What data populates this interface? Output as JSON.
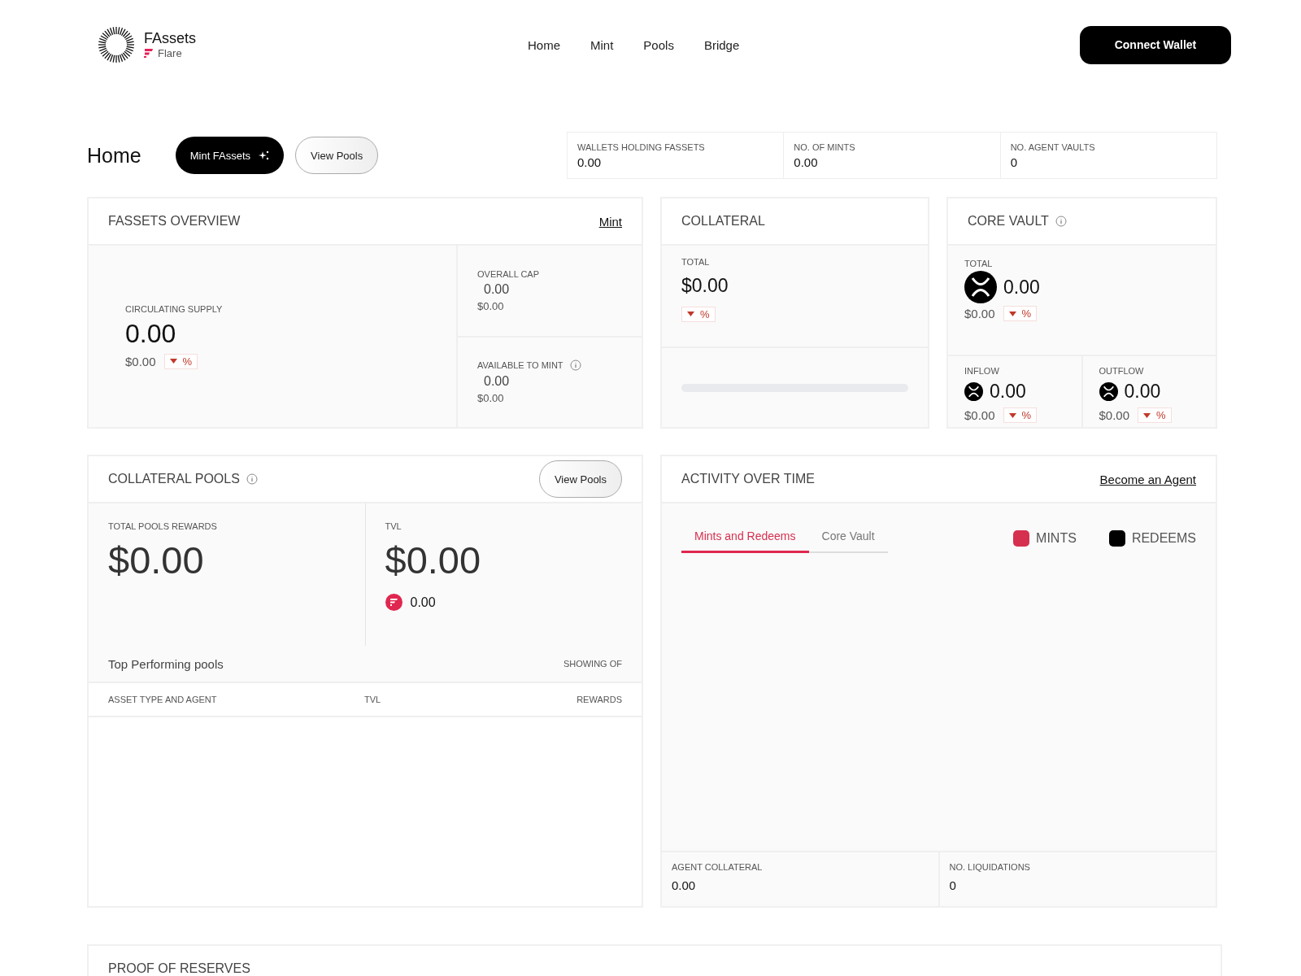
{
  "header": {
    "brand": "FAssets",
    "network": "Flare",
    "nav": [
      {
        "label": "Home"
      },
      {
        "label": "Mint"
      },
      {
        "label": "Pools"
      },
      {
        "label": "Bridge"
      }
    ],
    "connect_button": "Connect Wallet"
  },
  "page": {
    "title": "Home",
    "mint_button": "Mint FAssets",
    "view_pools_button": "View Pools"
  },
  "stats": [
    {
      "label": "WALLETS HOLDING FASSETS",
      "value": "0.00"
    },
    {
      "label": "NO. OF MINTS",
      "value": "0.00"
    },
    {
      "label": "NO. AGENT VAULTS",
      "value": "0"
    }
  ],
  "fassets_overview": {
    "title": "FASSETS OVERVIEW",
    "link": "Mint",
    "circulating": {
      "label": "CIRCULATING SUPPLY",
      "value": "0.00",
      "usd": "$0.00",
      "change": "%"
    },
    "overall_cap": {
      "label": "OVERALL CAP",
      "value": "0.00",
      "usd": "$0.00"
    },
    "available": {
      "label": "AVAILABLE TO MINT",
      "value": "0.00",
      "usd": "$0.00"
    }
  },
  "collateral": {
    "title": "COLLATERAL",
    "total_label": "TOTAL",
    "total": "$0.00",
    "change": "%"
  },
  "core_vault": {
    "title": "CORE VAULT",
    "total_label": "TOTAL",
    "total": "0.00",
    "usd": "$0.00",
    "change": "%",
    "flows": [
      {
        "label": "INFLOW",
        "value": "0.00",
        "usd": "$0.00",
        "change": "%"
      },
      {
        "label": "OUTFLOW",
        "value": "0.00",
        "usd": "$0.00",
        "change": "%"
      }
    ]
  },
  "collateral_pools": {
    "title": "COLLATERAL POOLS",
    "button": "View Pools",
    "rewards_label": "TOTAL POOLS REWARDS",
    "rewards": "$0.00",
    "tvl_label": "TVL",
    "tvl": "$0.00",
    "flr": "0.00",
    "top_title": "Top Performing pools",
    "showing": "SHOWING OF",
    "columns": [
      "ASSET TYPE AND AGENT",
      "TVL",
      "REWARDS"
    ]
  },
  "activity": {
    "title": "ACTIVITY OVER TIME",
    "link": "Become an Agent",
    "tabs": [
      {
        "label": "Mints and Redeems",
        "selected": true
      },
      {
        "label": "Core Vault",
        "selected": false
      }
    ],
    "legend": [
      {
        "label": "MINTS",
        "color": "#d6304f"
      },
      {
        "label": "REDEEMS",
        "color": "#000000"
      }
    ],
    "footer": [
      {
        "label": "AGENT COLLATERAL",
        "value": "0.00"
      },
      {
        "label": "NO. LIQUIDATIONS",
        "value": "0"
      }
    ]
  },
  "proof_of_reserves": {
    "title": "PROOF OF RESERVES"
  }
}
